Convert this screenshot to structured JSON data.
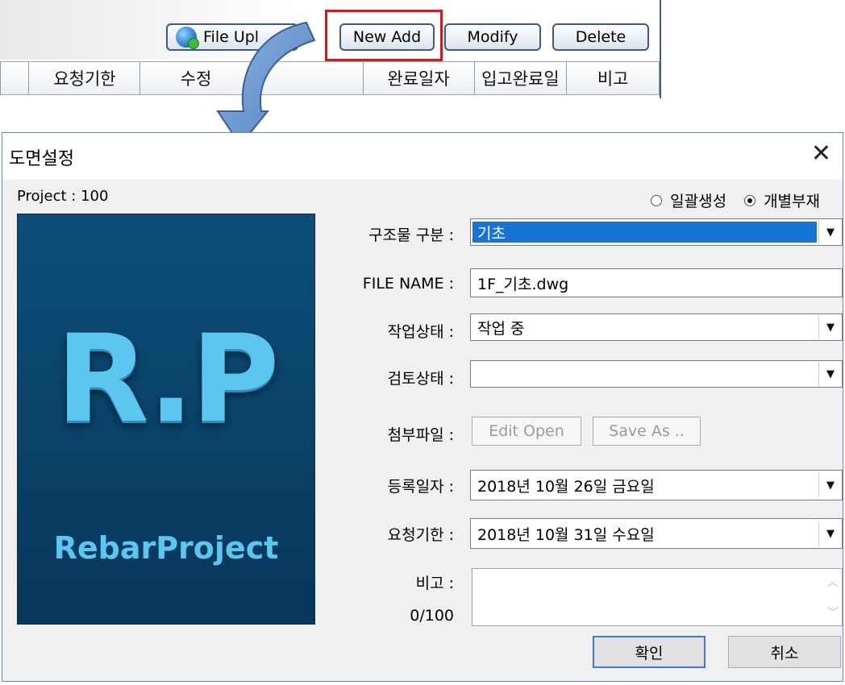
{
  "toolbar": {
    "file_upload_label": "File Upl",
    "new_add_label": "New Add",
    "modify_label": "Modify",
    "delete_label": "Delete",
    "columns": [
      "",
      "요청기한",
      "수정",
      "",
      "완료일자",
      "입고완료일",
      "비고"
    ]
  },
  "dialog": {
    "title": "도면설정",
    "close_symbol": "✕",
    "project_label": "Project : 100",
    "logo": {
      "mark": "R.P",
      "name": "RebarProject"
    },
    "radios": [
      {
        "label": "일괄생성",
        "checked": false
      },
      {
        "label": "개별부재",
        "checked": true
      }
    ],
    "fields": {
      "structure": {
        "label": "구조물 구분 :",
        "value": "기초"
      },
      "file_name": {
        "label": "FILE NAME :",
        "value": "1F_기초.dwg"
      },
      "work_status": {
        "label": "작업상태 :",
        "value": "작업 중"
      },
      "review_status": {
        "label": "검토상태 :",
        "value": ""
      },
      "attachment": {
        "label": "첨부파일 :",
        "edit_open": "Edit Open",
        "save_as": "Save As .."
      },
      "registered_date": {
        "label": "등록일자 :",
        "value": "2018년 10월 26일 금요일"
      },
      "request_deadline": {
        "label": "요청기한 :",
        "value": "2018년 10월 31일 수요일"
      },
      "remarks": {
        "label": "비고 :",
        "counter": "0/100",
        "value": ""
      }
    },
    "ok_label": "확인",
    "cancel_label": "취소"
  },
  "colors": {
    "accent": "#1874d4",
    "highlight_box": "#e01414",
    "logo_bg": "#0a4670"
  }
}
